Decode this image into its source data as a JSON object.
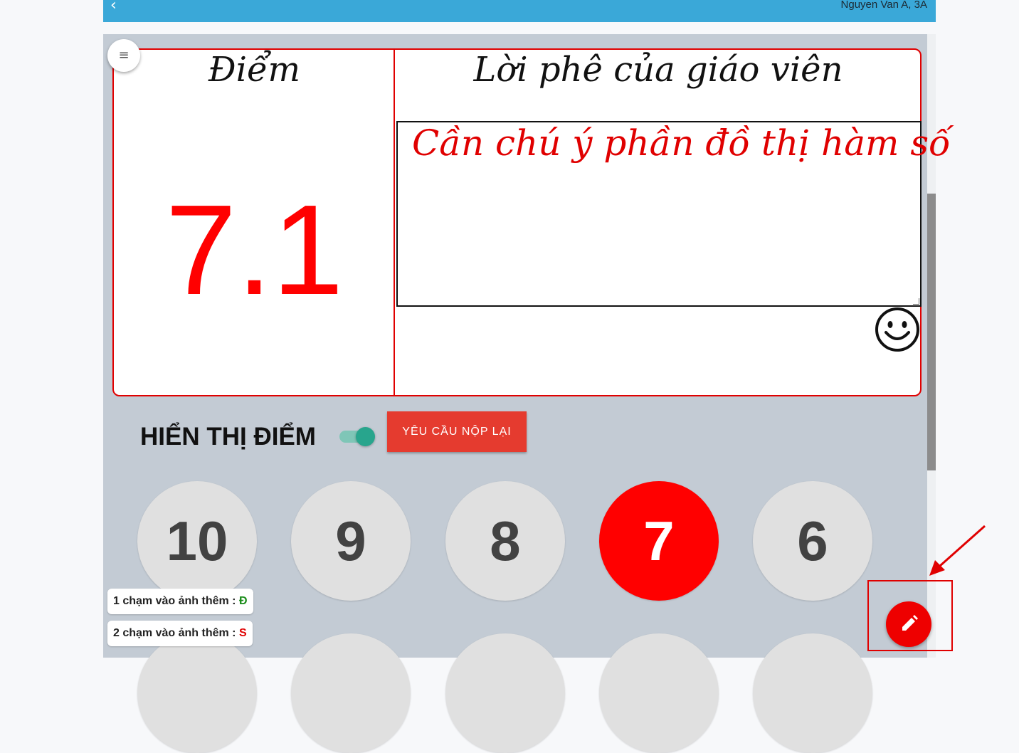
{
  "header": {
    "back_icon": "chevron-left-icon",
    "user_text": "Nguyen Van A, 3A"
  },
  "menu_icon": "hamburger-icon",
  "score_card": {
    "score_title": "Điểm",
    "score_value": "7.1",
    "comment_title": "Lời phê của giáo viên",
    "comment_text": "Cần chú ý phần đồ thị hàm số",
    "emoji_icon": "smiley-icon"
  },
  "controls": {
    "show_score_label": "HIỂN THỊ ĐIỂM",
    "show_score_on": true,
    "resubmit_label": "YÊU CẦU NỘP LẠI"
  },
  "grade_buttons": [
    "10",
    "9",
    "8",
    "7",
    "6"
  ],
  "selected_grade": "7",
  "hints": [
    {
      "text": "1 chạm vào ảnh thêm :",
      "mark": "Đ"
    },
    {
      "text": "2 chạm vào ảnh thêm :",
      "mark": "S"
    }
  ],
  "fab": {
    "icon": "pencil-icon"
  },
  "colors": {
    "header": "#3aa8d8",
    "accent_red": "#ff0000",
    "toggle": "#28a58d",
    "resubmit": "#e53b2f",
    "panel": "#c3cbd4"
  }
}
